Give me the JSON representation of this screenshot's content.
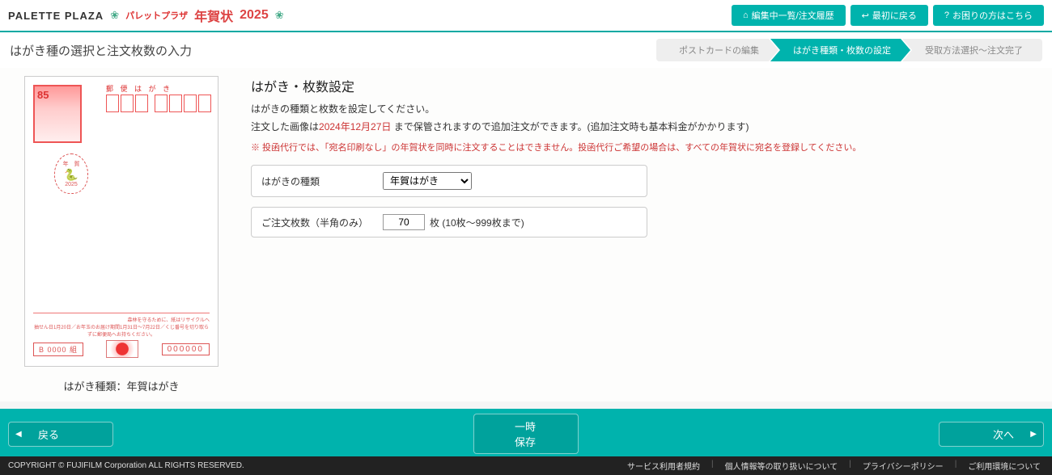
{
  "header": {
    "logo": "PALETTE PLAZA",
    "sublogo": "パレットプラザ",
    "nenga": "年賀状",
    "year": "2025",
    "buttons": {
      "edit_list": "編集中一覧/注文履歴",
      "back_top": "最初に戻る",
      "help": "お困りの方はこちら"
    }
  },
  "page_title": "はがき種の選択と注文枚数の入力",
  "steps": {
    "s1": "ポストカードの編集",
    "s2": "はがき種類・枚数の設定",
    "s3": "受取方法選択～注文完了"
  },
  "preview": {
    "stamp_value": "85",
    "yubin": "郵 便 は が き",
    "nenga_mark_top": "年　賀",
    "nenga_mark_year": "2025",
    "bottom_text1": "森林を守るために、紙はリサイクルへ",
    "bottom_text2": "抽せん日1月20日／お年玉のお届け期間1月31日～7月22日／くじ番号を切り取らずに郵便局へお持ちください。",
    "lottery_left": "B 0000 組",
    "lottery_right": "000000",
    "caption_label": "はがき種類：",
    "caption_value": "年賀はがき"
  },
  "form": {
    "title": "はがき・枚数設定",
    "desc1": "はがきの種類と枚数を設定してください。",
    "desc2a": "注文した画像は",
    "desc2_date": "2024年12月27日",
    "desc2b": " まで保管されますので追加注文ができます。(追加注文時も基本料金がかかります)",
    "warning": "※ 投函代行では、「宛名印刷なし」の年賀状を同時に注文することはできません。投函代行ご希望の場合は、すべての年賀状に宛名を登録してください。",
    "type_label": "はがきの種類",
    "type_value": "年賀はがき",
    "qty_label": "ご注文枚数（半角のみ）",
    "qty_value": "70",
    "qty_suffix": "枚 (10枚～999枚まで)"
  },
  "footer": {
    "back": "戻る",
    "save": "一時保存",
    "next": "次へ"
  },
  "copyright": "COPYRIGHT © FUJIFILM Corporation ALL RIGHTS RESERVED.",
  "footer_links": {
    "l1": "サービス利用者規約",
    "l2": "個人情報等の取り扱いについて",
    "l3": "プライバシーポリシー",
    "l4": "ご利用環境について"
  }
}
